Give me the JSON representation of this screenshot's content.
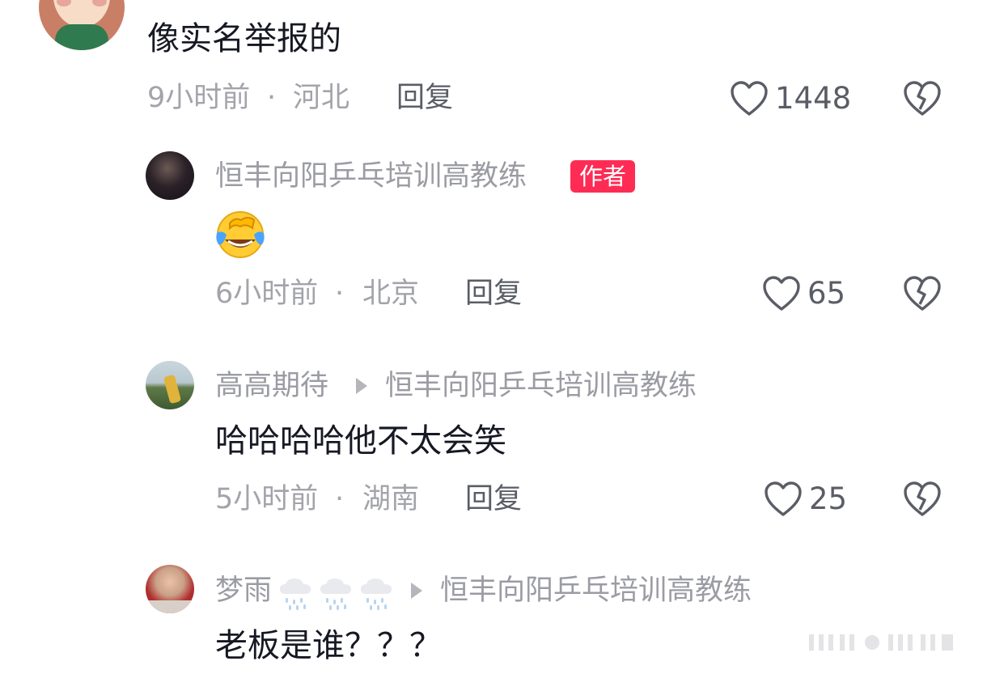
{
  "comments": [
    {
      "text": "像实名举报的",
      "time": "9小时前",
      "location": "河北",
      "reply_label": "回复",
      "likes": "1448"
    },
    {
      "user": "恒丰向阳乒乓培训高教练",
      "author_badge": "作者",
      "text_emoji": "crying-laughing-emoji",
      "time": "6小时前",
      "location": "北京",
      "reply_label": "回复",
      "likes": "65"
    },
    {
      "user": "高高期待",
      "reply_to": "恒丰向阳乒乓培训高教练",
      "text": "哈哈哈哈他不太会笑",
      "time": "5小时前",
      "location": "湖南",
      "reply_label": "回复",
      "likes": "25"
    },
    {
      "user": "梦雨",
      "user_decoration_icons": [
        "rain-cloud-icon",
        "rain-cloud-icon",
        "rain-cloud-icon"
      ],
      "reply_to": "恒丰向阳乒乓培训高教练",
      "text": "老板是谁？？？"
    }
  ],
  "separator": "·",
  "colors": {
    "badge": "#fe2c55",
    "meta": "#a3a4aa",
    "name": "#9b9ca3",
    "text": "#161823"
  }
}
